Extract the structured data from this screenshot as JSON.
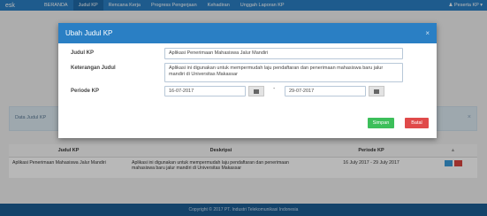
{
  "navbar": {
    "brand": "esk",
    "items": [
      "BERANDA",
      "Judul KP",
      "Rencana Kerja",
      "Progress Pengerjaan",
      "Kehadiran",
      "Unggah Laporan KP"
    ],
    "user": "Peserta KP"
  },
  "info": {
    "label": "Data Judul KP"
  },
  "table": {
    "headers": [
      "Judul KP",
      "Deskripsi",
      "Periode KP"
    ],
    "row": {
      "judul": "Aplikasi Penerimaan Mahasiswa Jalur Mandiri",
      "deskripsi": "Aplikasi ini digunakan untuk mempermudah laju pendaftaran dan penerimaan mahasiswa baru jalur mandiri di Universitas Makassar",
      "periode": "16 July 2017 - 29 July 2017"
    }
  },
  "footer": {
    "text": "Copyright © 2017 PT. Industri Telekomunikasi Indonesia"
  },
  "modal": {
    "title": "Ubah Judul KP",
    "labels": {
      "judul": "Judul KP",
      "keterangan": "Keterangan Judul",
      "periode": "Periode KP"
    },
    "values": {
      "judul": "Aplikasi Penerimaan Mahasiswa Jalur Mandiri",
      "keterangan": "Aplikasi ini digunakan untuk mempermudah laju pendaftaran dan penerimaan mahasiswa baru jalur mandiri di Universitas Makassar",
      "start": "16-07-2017",
      "end": "29-07-2017"
    },
    "separator": "-",
    "buttons": {
      "save": "Simpan",
      "cancel": "Batal"
    }
  },
  "colors": {
    "primary": "#2a7fc4",
    "save": "#3cbf5a",
    "cancel": "#e04a4a"
  }
}
